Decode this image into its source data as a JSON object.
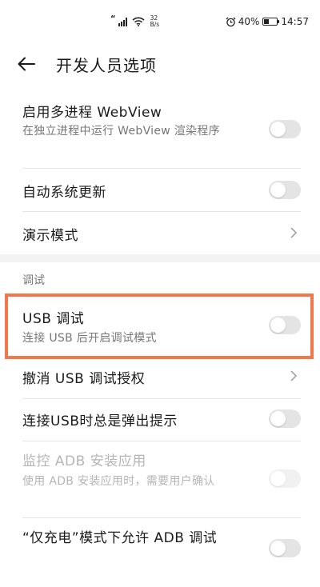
{
  "status_bar": {
    "quote": "“",
    "speed_value": "32",
    "speed_unit": "B/s",
    "battery": "40%",
    "battery_level": 0.4,
    "time": "14:57"
  },
  "header": {
    "title": "开发人员选项"
  },
  "items": {
    "multiprocess_webview": {
      "title": "启用多进程 WebView",
      "subtitle": "在独立进程中运行 WebView 渲染程序",
      "toggle_on": false
    },
    "auto_update": {
      "title": "自动系统更新",
      "toggle_on": false
    },
    "demo_mode": {
      "title": "演示模式"
    },
    "usb_debugging": {
      "title": "USB 调试",
      "subtitle": "连接 USB 后开启调试模式",
      "toggle_on": false
    },
    "revoke_usb_auth": {
      "title": "撤消 USB 调试授权"
    },
    "usb_prompt": {
      "title": "连接USB时总是弹出提示",
      "toggle_on": false
    },
    "monitor_adb": {
      "title": "监控 ADB 安装应用",
      "subtitle": "使用 ADB 安装应用时，需要用户确认",
      "enabled": false,
      "toggle_on": false
    },
    "charge_only_adb": {
      "title": "“仅充电”模式下允许 ADB 调试",
      "toggle_on": false
    }
  },
  "sections": {
    "debug_label": "调试"
  },
  "colors": {
    "highlight": "#f2784b",
    "toggle_off": "#e4e4e4",
    "secondary_text": "#777777",
    "disabled_text": "#b5b5b5"
  }
}
